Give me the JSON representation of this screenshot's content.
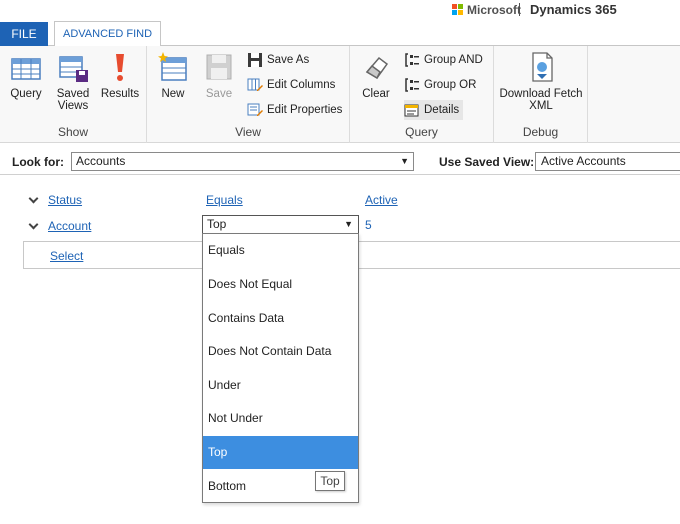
{
  "brand": {
    "microsoft": "Microsoft",
    "product": "Dynamics 365"
  },
  "tabs": {
    "file": "FILE",
    "advanced_find": "ADVANCED FIND"
  },
  "ribbon": {
    "show": {
      "label": "Show",
      "query": "Query",
      "saved_views": "Saved Views",
      "results": "Results"
    },
    "view": {
      "label": "View",
      "new": "New",
      "save": "Save",
      "save_as": "Save As",
      "edit_columns": "Edit Columns",
      "edit_properties": "Edit Properties"
    },
    "query": {
      "label": "Query",
      "clear": "Clear",
      "group_and": "Group AND",
      "group_or": "Group OR",
      "details": "Details"
    },
    "debug": {
      "label": "Debug",
      "download_fetch": "Download Fetch XML"
    }
  },
  "lookfor": {
    "label": "Look for:",
    "value": "Accounts",
    "saved_view_label": "Use Saved View:",
    "saved_view_value": "Active Accounts"
  },
  "criteria": {
    "rows": [
      {
        "field": "Status",
        "operator": "Equals",
        "value": "Active"
      },
      {
        "field": "Account",
        "operator": "Top",
        "value": "5"
      }
    ],
    "select": "Select"
  },
  "dropdown": {
    "options": [
      "Equals",
      "Does Not Equal",
      "Contains Data",
      "Does Not Contain Data",
      "Under",
      "Not Under",
      "Top",
      "Bottom"
    ],
    "selected": "Top",
    "tooltip": "Top"
  }
}
